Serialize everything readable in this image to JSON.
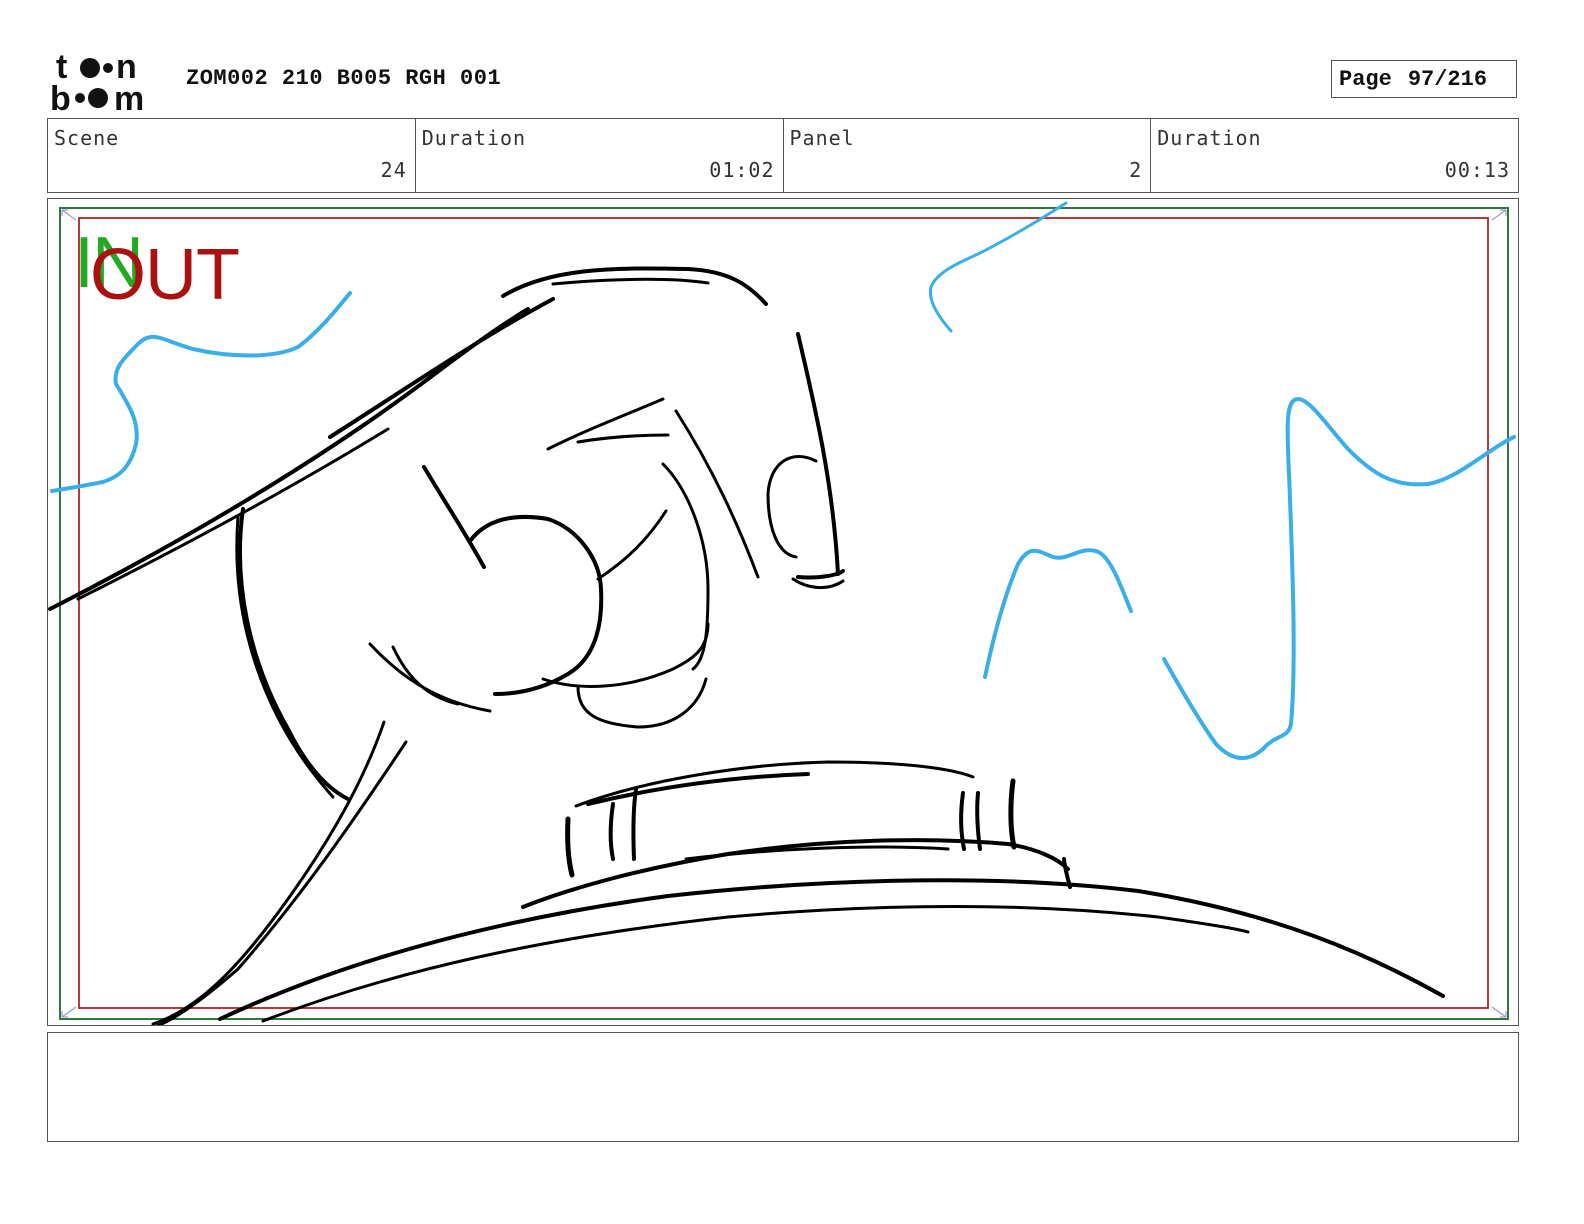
{
  "header": {
    "logo_text": "toon boom",
    "title": "ZOM002 210 B005 RGH 001",
    "page_label": "Page",
    "page_number": "97/216"
  },
  "info": {
    "scene_label": "Scene",
    "scene_value": "24",
    "scene_duration_label": "Duration",
    "scene_duration_value": "01:02",
    "panel_label": "Panel",
    "panel_value": "2",
    "panel_duration_label": "Duration",
    "panel_duration_value": "00:13"
  },
  "panel": {
    "in_marker": "IN",
    "out_marker": "OUT",
    "colors": {
      "sketch": "#000000",
      "effects": "#3aaee8",
      "safe_frame_outer": "#2d7a3a",
      "safe_frame_inner": "#b22222",
      "in_marker": "#22aa22",
      "out_marker": "#aa1111"
    }
  },
  "notes": {
    "text": ""
  }
}
